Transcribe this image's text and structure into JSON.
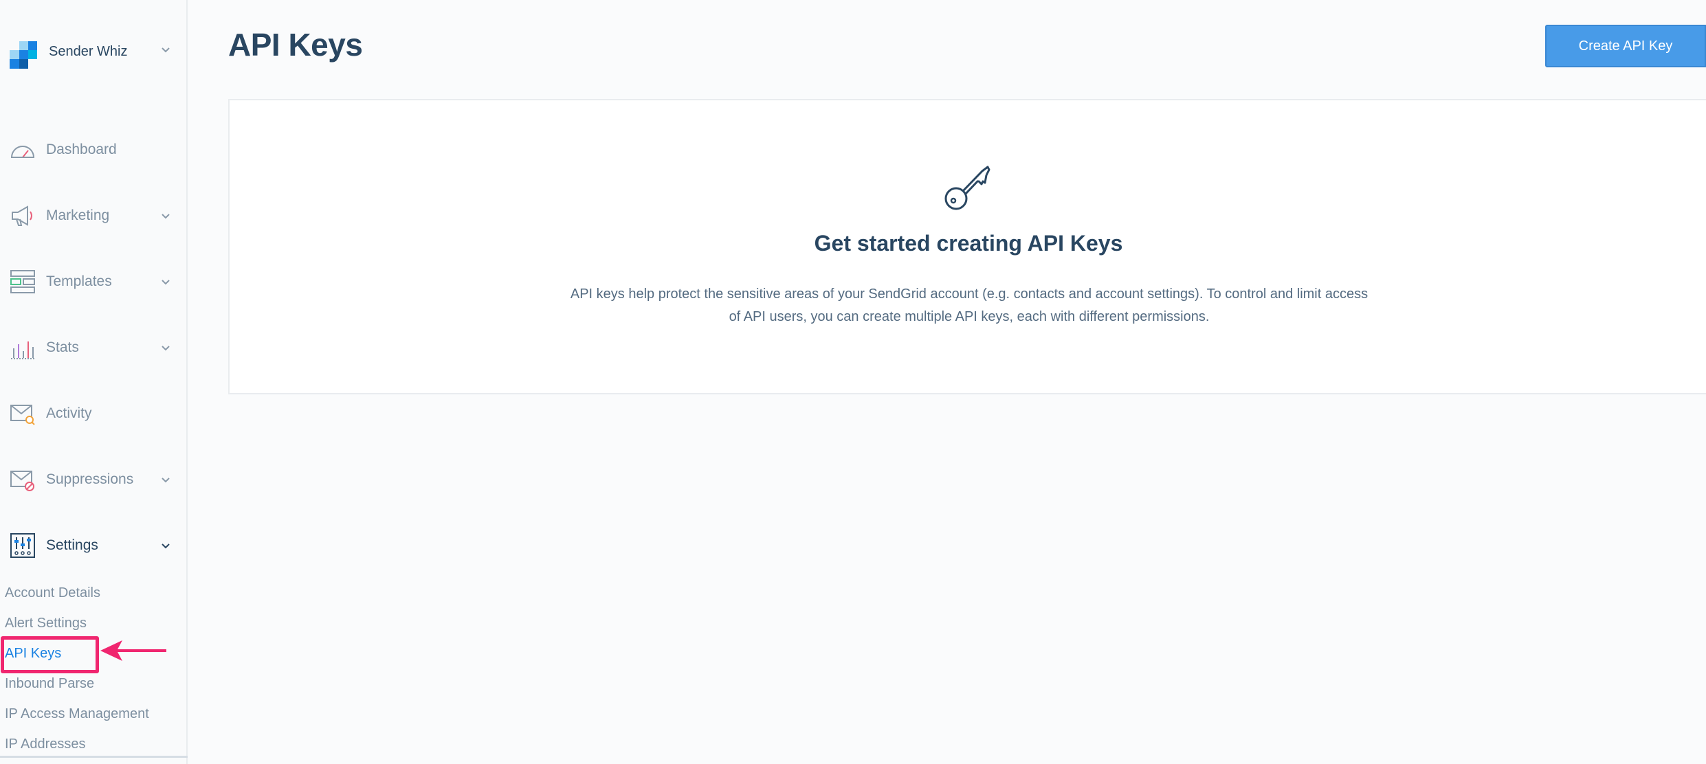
{
  "account": {
    "name": "Sender Whiz"
  },
  "nav": {
    "items": [
      {
        "label": "Dashboard",
        "icon": "dashboard-gauge-icon"
      },
      {
        "label": "Marketing",
        "icon": "megaphone-icon"
      },
      {
        "label": "Templates",
        "icon": "templates-icon"
      },
      {
        "label": "Stats",
        "icon": "bar-chart-icon"
      },
      {
        "label": "Activity",
        "icon": "envelope-search-icon"
      },
      {
        "label": "Suppressions",
        "icon": "envelope-block-icon"
      },
      {
        "label": "Settings",
        "icon": "sliders-icon"
      }
    ],
    "settings_sub": [
      "Account Details",
      "Alert Settings",
      "API Keys",
      "Inbound Parse",
      "IP Access Management",
      "IP Addresses"
    ]
  },
  "page": {
    "title": "API Keys",
    "create_button": "Create API Key"
  },
  "empty_state": {
    "icon": "key-icon",
    "title": "Get started creating API Keys",
    "description": "API keys help protect the sensitive areas of your SendGrid account (e.g. contacts and account settings). To control and limit access of API users, you can create multiple API keys, each with different permissions."
  },
  "colors": {
    "accent": "#1a82e2",
    "button": "#489be8",
    "highlight": "#f0266f",
    "text_dark": "#294661",
    "text_muted": "#7d8fa0"
  }
}
